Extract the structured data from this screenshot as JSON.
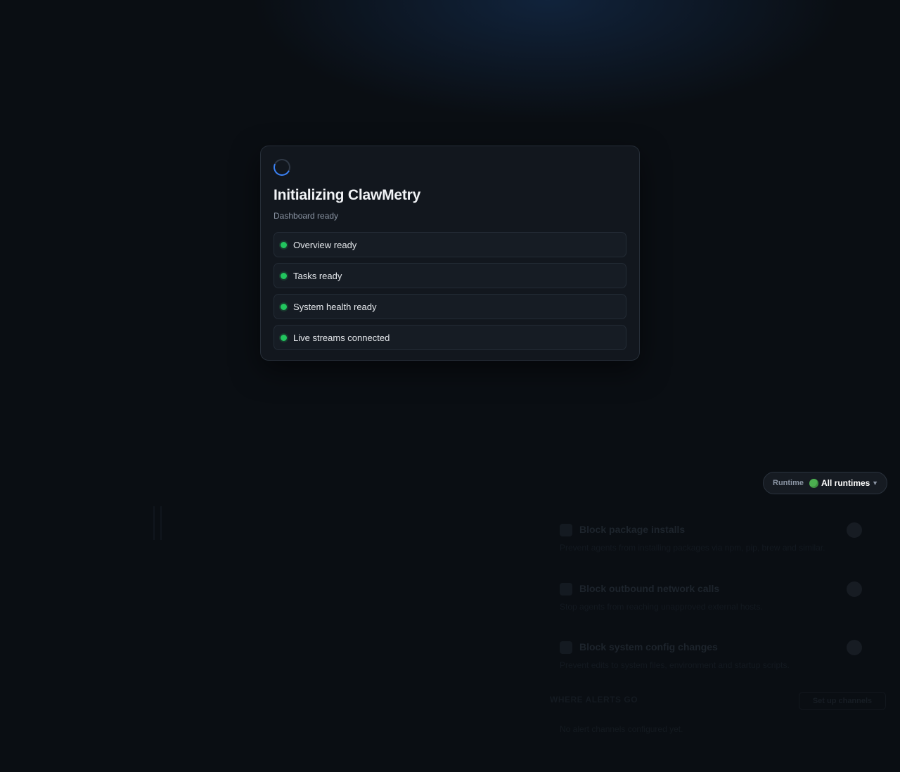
{
  "loading_modal": {
    "title": "Initializing ClawMetry",
    "status": "Dashboard ready",
    "steps": [
      {
        "label": "Overview ready",
        "state": "done"
      },
      {
        "label": "Tasks ready",
        "state": "done"
      },
      {
        "label": "System health ready",
        "state": "done"
      },
      {
        "label": "Live streams connected",
        "state": "done"
      }
    ]
  },
  "runtime_selector": {
    "label": "Runtime",
    "value": "All runtimes",
    "status_color": "#4caf50"
  },
  "background": {
    "policies": [
      {
        "title": "Block package installs",
        "description": "Prevent agents from installing packages via npm, pip, brew and similar.",
        "icon": "package-icon"
      },
      {
        "title": "Block outbound network calls",
        "description": "Stop agents from reaching unapproved external hosts.",
        "icon": "network-icon"
      },
      {
        "title": "Block system config changes",
        "description": "Prevent edits to system files, environment and startup scripts.",
        "icon": "gear-icon"
      }
    ],
    "alerts_section_title": "WHERE ALERTS GO",
    "setup_button": "Set up channels",
    "empty_note": "No alert channels configured yet."
  },
  "colors": {
    "accent": "#3b82f6",
    "success": "#22c55e",
    "background": "#0a0e13",
    "surface": "#12171e"
  }
}
